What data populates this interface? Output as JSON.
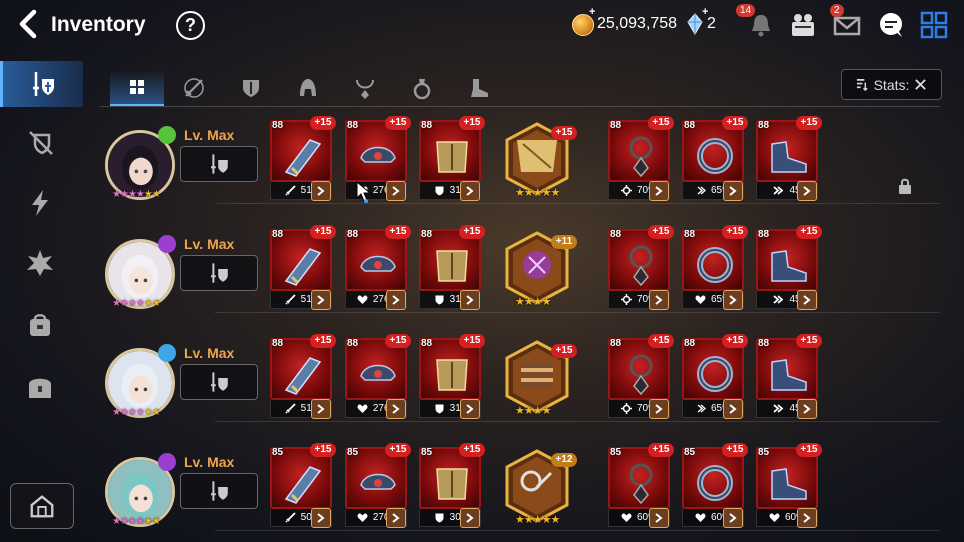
{
  "header": {
    "title": "Inventory",
    "help_label": "?",
    "gold": "25,093,758",
    "gems": "2",
    "notification_count": "14",
    "mail_count": "2",
    "currency_plus": "+"
  },
  "tabs": [
    "all",
    "weapon",
    "armor",
    "helmet",
    "necklace",
    "ring",
    "boots"
  ],
  "stats_button": "Stats:",
  "heroes": [
    {
      "level": "Lv. Max",
      "element": "earth",
      "element_color": "#58c23a",
      "artifact_enhance": "+15",
      "artifact_stars": "★★★★★",
      "slots": [
        {
          "lvl": "88",
          "enh": "+15",
          "stat_icon": "attack",
          "stat": "515"
        },
        {
          "lvl": "88",
          "enh": "+15",
          "stat_icon": "health",
          "stat": "2765"
        },
        {
          "lvl": "88",
          "enh": "+15",
          "stat_icon": "defense",
          "stat": "310"
        },
        {
          "lvl": "88",
          "enh": "+15",
          "stat_icon": "crit-rate",
          "stat": "70%"
        },
        {
          "lvl": "88",
          "enh": "+15",
          "stat_icon": "crit-damage",
          "stat": "65%"
        },
        {
          "lvl": "88",
          "enh": "+15",
          "stat_icon": "speed",
          "stat": "45"
        }
      ]
    },
    {
      "level": "Lv. Max",
      "element": "dark",
      "element_color": "#9b3fd0",
      "artifact_enhance": "+11",
      "artifact_stars": "★★★★",
      "slots": [
        {
          "lvl": "88",
          "enh": "+15",
          "stat_icon": "attack",
          "stat": "515"
        },
        {
          "lvl": "88",
          "enh": "+15",
          "stat_icon": "health",
          "stat": "2765"
        },
        {
          "lvl": "88",
          "enh": "+15",
          "stat_icon": "defense",
          "stat": "310"
        },
        {
          "lvl": "88",
          "enh": "+15",
          "stat_icon": "crit-rate",
          "stat": "70%"
        },
        {
          "lvl": "88",
          "enh": "+15",
          "stat_icon": "health",
          "stat": "65%"
        },
        {
          "lvl": "88",
          "enh": "+15",
          "stat_icon": "speed",
          "stat": "45"
        }
      ]
    },
    {
      "level": "Lv. Max",
      "element": "ice",
      "element_color": "#3fa4e8",
      "artifact_enhance": "+15",
      "artifact_stars": "★★★★",
      "slots": [
        {
          "lvl": "88",
          "enh": "+15",
          "stat_icon": "attack",
          "stat": "515"
        },
        {
          "lvl": "88",
          "enh": "+15",
          "stat_icon": "health",
          "stat": "2765"
        },
        {
          "lvl": "88",
          "enh": "+15",
          "stat_icon": "defense",
          "stat": "310"
        },
        {
          "lvl": "88",
          "enh": "+15",
          "stat_icon": "crit-rate",
          "stat": "70%"
        },
        {
          "lvl": "88",
          "enh": "+15",
          "stat_icon": "crit-damage",
          "stat": "65%"
        },
        {
          "lvl": "88",
          "enh": "+15",
          "stat_icon": "speed",
          "stat": "45"
        }
      ]
    },
    {
      "level": "Lv. Max",
      "element": "dark",
      "element_color": "#9b3fd0",
      "artifact_enhance": "+12",
      "artifact_stars": "★★★★★",
      "slots": [
        {
          "lvl": "85",
          "enh": "+15",
          "stat_icon": "attack",
          "stat": "500"
        },
        {
          "lvl": "85",
          "enh": "+15",
          "stat_icon": "health",
          "stat": "2700"
        },
        {
          "lvl": "85",
          "enh": "+15",
          "stat_icon": "defense",
          "stat": "300"
        },
        {
          "lvl": "85",
          "enh": "+15",
          "stat_icon": "health",
          "stat": "60%"
        },
        {
          "lvl": "85",
          "enh": "+15",
          "stat_icon": "health",
          "stat": "60%"
        },
        {
          "lvl": "85",
          "enh": "+15",
          "stat_icon": "health",
          "stat": "60%"
        }
      ]
    }
  ],
  "colors": {
    "accent": "#5fb4ff",
    "slot_red": "#9a1616",
    "level_text": "#f0a44a",
    "star": "#f4b623"
  }
}
